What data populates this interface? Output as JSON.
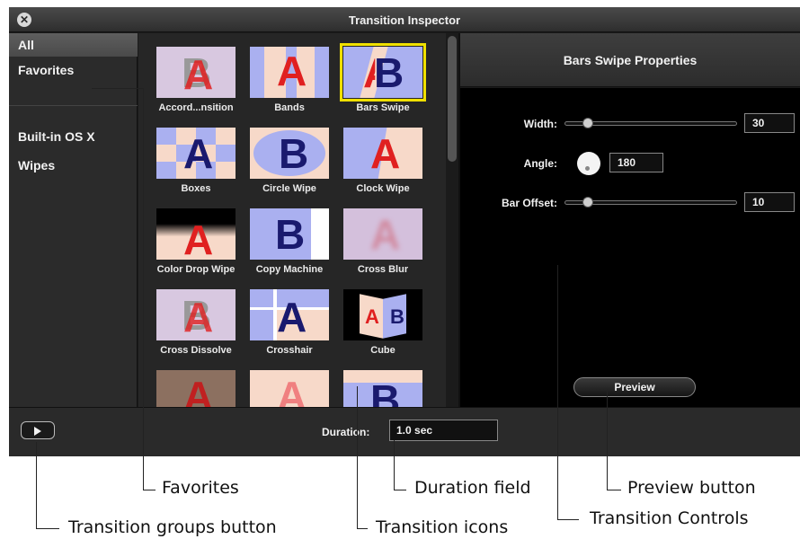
{
  "window": {
    "title": "Transition Inspector"
  },
  "sidebar": {
    "items": [
      {
        "label": "All",
        "selected": true
      },
      {
        "label": "Favorites",
        "selected": false
      },
      {
        "label": "Built-in OS X",
        "selected": false
      },
      {
        "label": "Wipes",
        "selected": false
      }
    ]
  },
  "transitions": [
    {
      "label": "Accord...nsition",
      "icon": "accordion-transition-icon"
    },
    {
      "label": "Bands",
      "icon": "bands-transition-icon"
    },
    {
      "label": "Bars Swipe",
      "icon": "bars-swipe-transition-icon",
      "selected": true
    },
    {
      "label": "Boxes",
      "icon": "boxes-transition-icon"
    },
    {
      "label": "Circle Wipe",
      "icon": "circle-wipe-transition-icon"
    },
    {
      "label": "Clock Wipe",
      "icon": "clock-wipe-transition-icon"
    },
    {
      "label": "Color Drop Wipe",
      "icon": "color-drop-wipe-transition-icon"
    },
    {
      "label": "Copy Machine",
      "icon": "copy-machine-transition-icon"
    },
    {
      "label": "Cross Blur",
      "icon": "cross-blur-transition-icon"
    },
    {
      "label": "Cross Dissolve",
      "icon": "cross-dissolve-transition-icon"
    },
    {
      "label": "Crosshair",
      "icon": "crosshair-transition-icon"
    },
    {
      "label": "Cube",
      "icon": "cube-transition-icon"
    },
    {
      "label": "",
      "icon": "transition-thumbnail-icon"
    },
    {
      "label": "",
      "icon": "transition-thumbnail-icon"
    },
    {
      "label": "",
      "icon": "transition-thumbnail-icon"
    }
  ],
  "properties": {
    "title": "Bars Swipe Properties",
    "width": {
      "label": "Width:",
      "value": "30",
      "fraction": 0.12
    },
    "angle": {
      "label": "Angle:",
      "value": "180"
    },
    "bar_offset": {
      "label": "Bar Offset:",
      "value": "10",
      "fraction": 0.12
    },
    "preview_label": "Preview"
  },
  "bottom": {
    "duration_label": "Duration:",
    "duration_value": "1.0 sec"
  },
  "callouts": {
    "favorites": "Favorites",
    "duration_field": "Duration field",
    "preview_button": "Preview button",
    "transition_groups_button": "Transition groups button",
    "transition_icons": "Transition icons",
    "transition_controls": "Transition Controls"
  },
  "colors": {
    "selection": "#f0e000",
    "thumb_red": "#e02020",
    "thumb_blue": "#1a1a6e",
    "thumb_periwinkle": "#aab0f0",
    "thumb_peach": "#f7d9c9"
  }
}
